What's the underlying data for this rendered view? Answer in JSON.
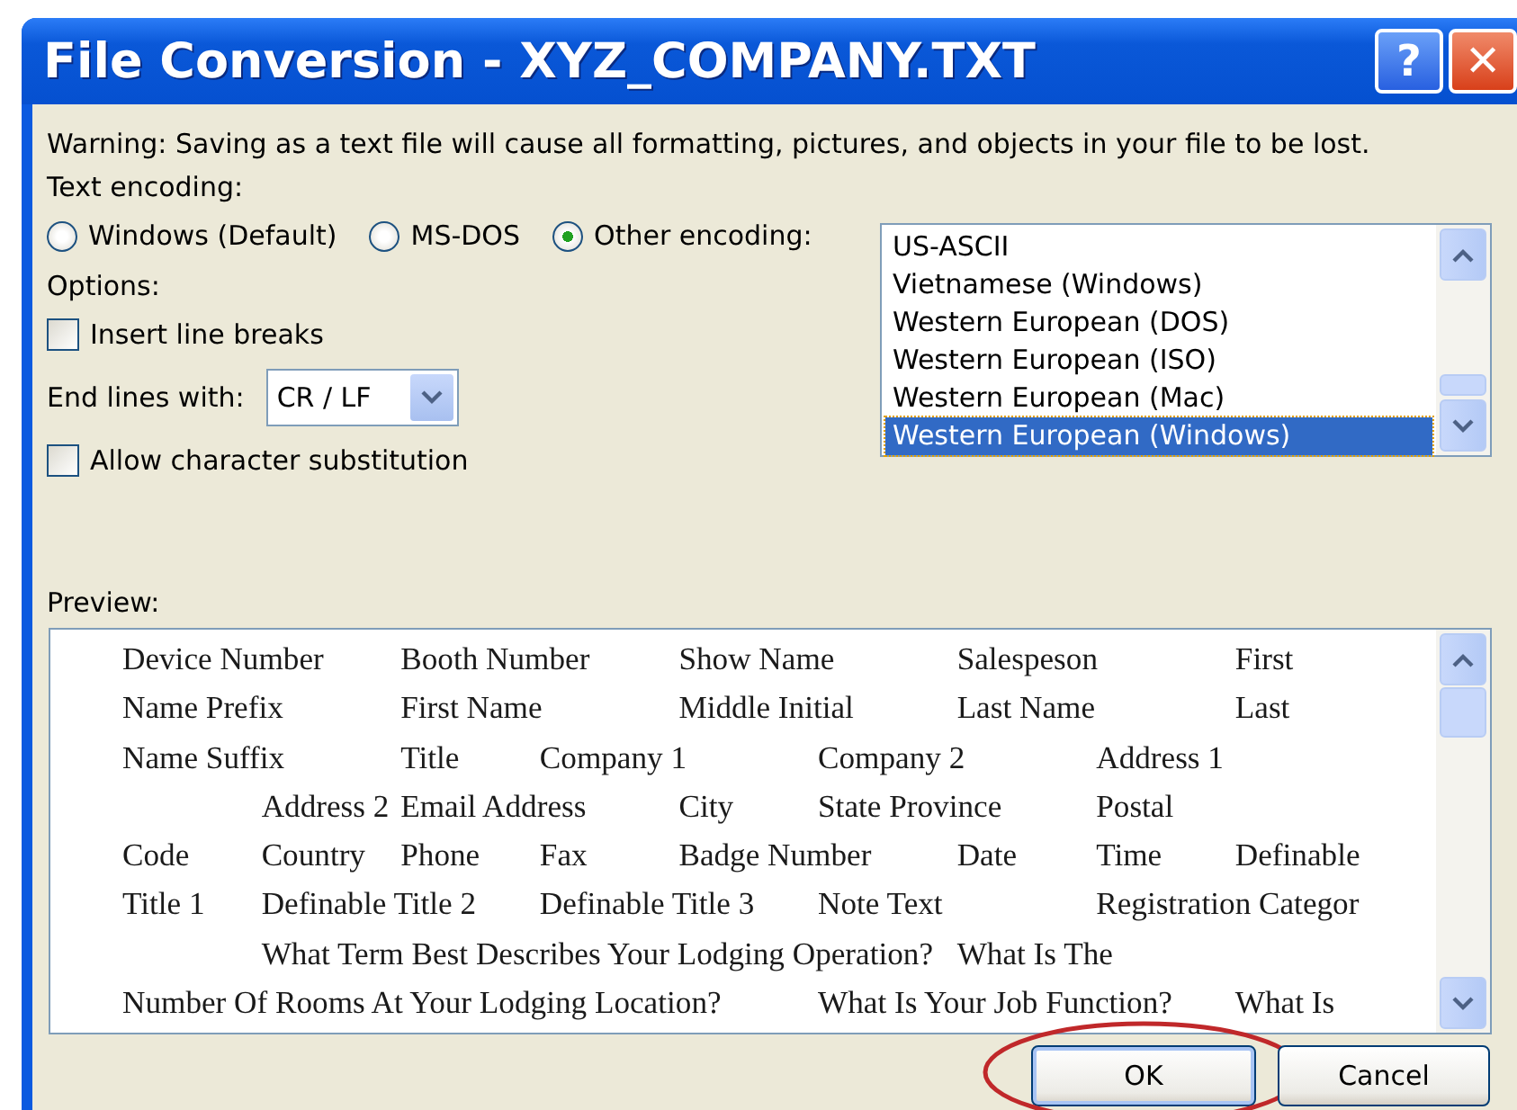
{
  "window": {
    "title": "File Conversion - XYZ_COMPANY.TXT",
    "title_buttons": [
      {
        "kind": "help",
        "label": "?"
      },
      {
        "kind": "close",
        "label": "✕"
      }
    ]
  },
  "warning": "Warning: Saving as a text file will cause all formatting, pictures, and objects in your file to be lost.",
  "encoding_label": "Text encoding:",
  "encoding_options": [
    {
      "label": "Windows (Default)",
      "selected": false
    },
    {
      "label": "MS-DOS",
      "selected": false
    },
    {
      "label": "Other encoding:",
      "selected": true
    }
  ],
  "encoding_list": [
    {
      "label": "US-ASCII",
      "selected": false
    },
    {
      "label": "Vietnamese (Windows)",
      "selected": false
    },
    {
      "label": "Western European (DOS)",
      "selected": false
    },
    {
      "label": "Western European (ISO)",
      "selected": false
    },
    {
      "label": "Western European (Mac)",
      "selected": false
    },
    {
      "label": "Western European (Windows)",
      "selected": true
    }
  ],
  "options_label": "Options:",
  "insert_line_breaks": {
    "label": "Insert line breaks",
    "checked": false
  },
  "end_lines": {
    "label": "End lines with:",
    "value": "CR / LF"
  },
  "allow_substitution": {
    "label": "Allow character substitution",
    "checked": false
  },
  "preview_label": "Preview:",
  "preview_lines": [
    "Device Number\tBooth Number\tShow Name\tSalespeson\tFirst",
    "Name Prefix\tFirst Name\tMiddle Initial\tLast Name\tLast",
    "Name Suffix\tTitle\tCompany 1\tCompany 2\tAddress 1",
    "\tAddress 2\tEmail Address\tCity\tState Province\tPostal",
    "Code\tCountry\tPhone\tFax\tBadge Number\tDate\tTime\tDefinable",
    "Title 1\tDefinable Title 2\tDefinable Title 3\tNote Text\t\tRegistration Categor",
    "\tWhat Term Best Describes Your Lodging Operation?\tWhat Is The",
    "Number Of Rooms At Your Lodging Location?\tWhat Is Your Job Function?\tWhat Is"
  ],
  "buttons": [
    {
      "label": "OK",
      "highlighted": true
    },
    {
      "label": "Cancel",
      "highlighted": false
    }
  ]
}
